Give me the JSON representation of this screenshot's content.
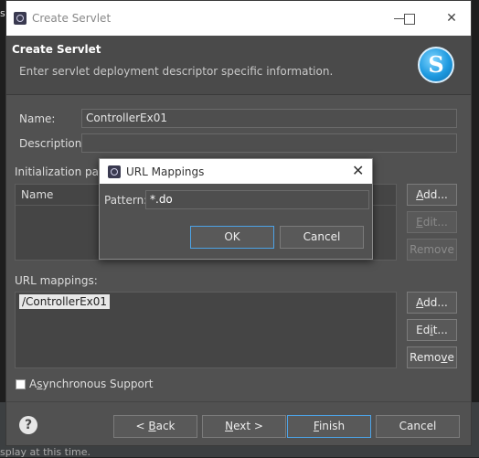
{
  "background": {
    "top_fragment": "s",
    "bottom_text": "splay at this time."
  },
  "window": {
    "title": "Create Servlet",
    "minimize_label": "—",
    "maximize_label": "☐",
    "close_label": "✕"
  },
  "banner": {
    "title": "Create Servlet",
    "subtitle": "Enter servlet deployment descriptor specific information.",
    "logo_letter": "S"
  },
  "form": {
    "name_label": "Name:",
    "name_value": "ControllerEx01",
    "description_label": "Description:",
    "description_value": "",
    "init_params_label": "Initialization para",
    "init_params_column": "Name",
    "url_mappings_label": "URL mappings:",
    "url_mappings": [
      "/ControllerEx01"
    ],
    "async_label_prefix": "A",
    "async_label_underlined": "s",
    "async_label_rest": "ynchronous Support",
    "async_checked": false
  },
  "buttons": {
    "init_add": {
      "u": "A",
      "rest": "dd..."
    },
    "init_edit": {
      "u": "E",
      "rest": "dit..."
    },
    "init_remove": "Remove",
    "url_add": {
      "u": "A",
      "rest": "dd..."
    },
    "url_edit": {
      "pre": "Ed",
      "u": "i",
      "rest": "t..."
    },
    "url_remove": {
      "pre": "Remo",
      "u": "v",
      "rest": "e"
    },
    "back": {
      "pre": "< ",
      "u": "B",
      "rest": "ack"
    },
    "next": {
      "u": "N",
      "rest": "ext >"
    },
    "finish": {
      "u": "F",
      "rest": "inish"
    },
    "cancel": "Cancel",
    "help": "?"
  },
  "subdialog": {
    "title": "URL Mappings",
    "close_label": "✕",
    "pattern_label": "Pattern:",
    "pattern_value": "*.do",
    "ok_label": "OK",
    "cancel_label": "Cancel"
  },
  "colors": {
    "dialog_bg": "#515151",
    "accent": "#4da3e6",
    "titlebar": "#ffffff"
  }
}
